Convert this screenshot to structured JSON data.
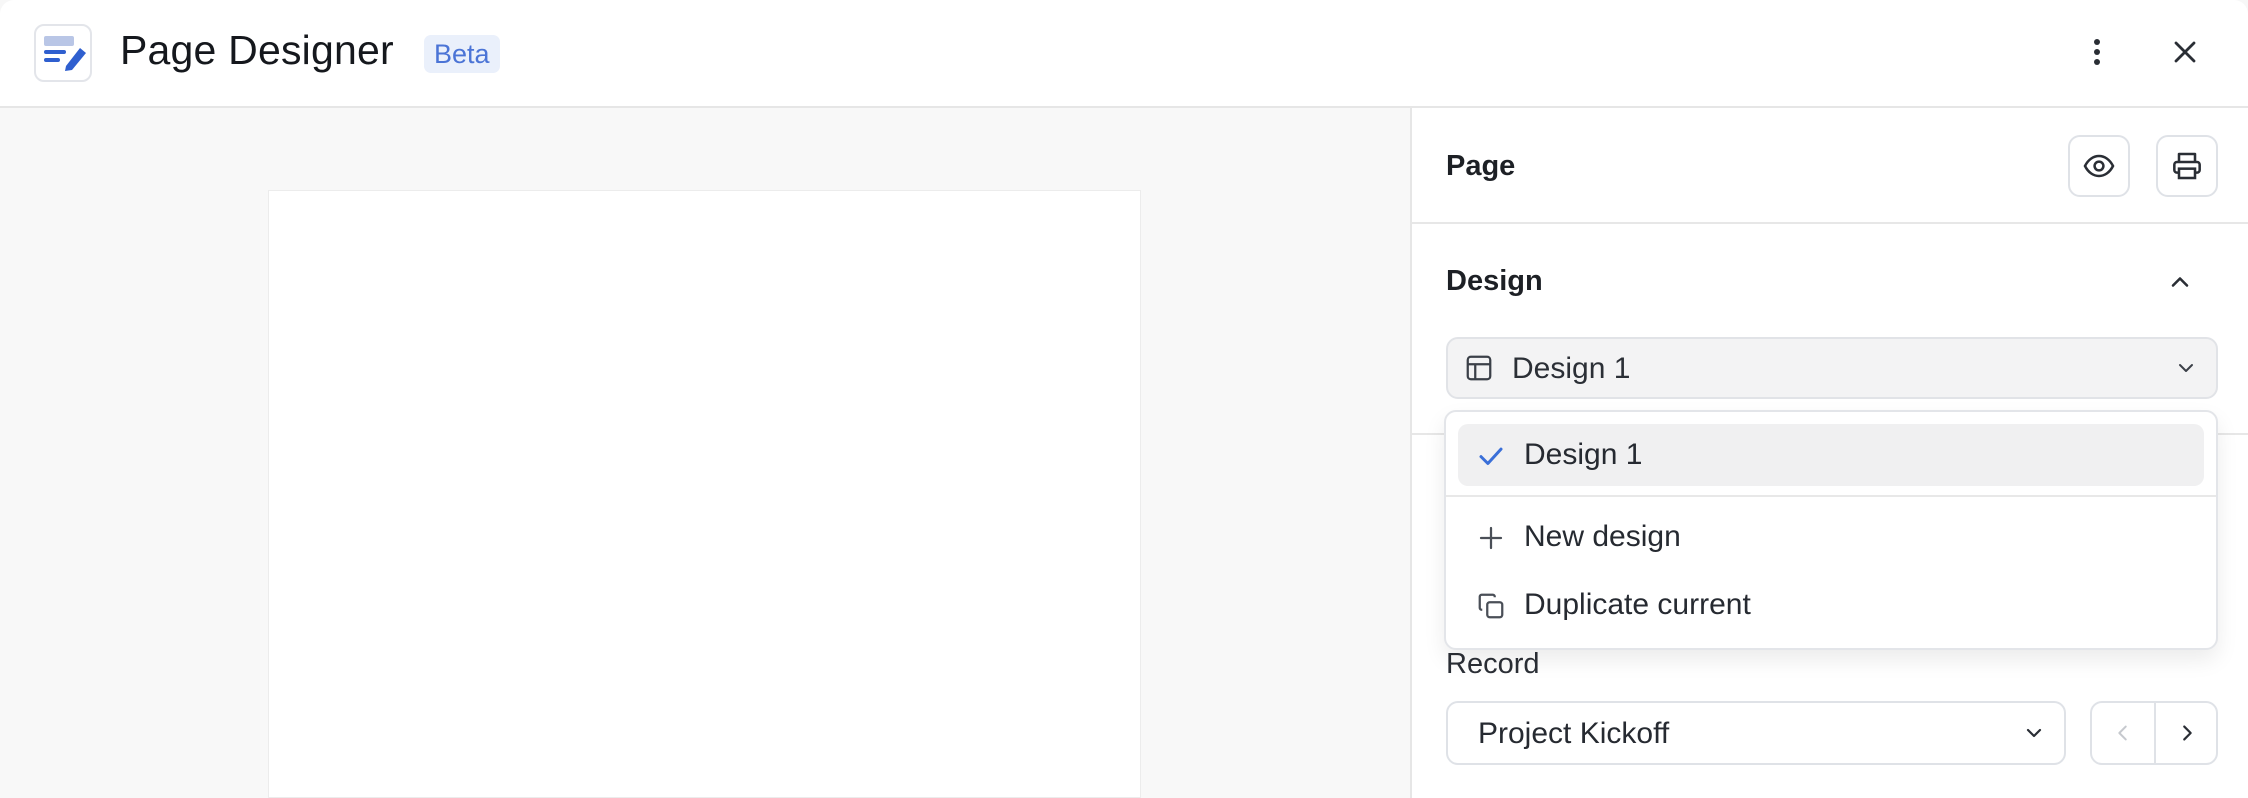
{
  "header": {
    "title": "Page Designer",
    "badge": "Beta",
    "icons": {
      "app": "page-designer-icon",
      "more": "more-vertical-icon",
      "close": "close-icon"
    }
  },
  "panel": {
    "page_title": "Page",
    "preview_icon": "eye-icon",
    "print_icon": "printer-icon",
    "design_section_title": "Design",
    "design_collapse_icon": "chevron-up-icon",
    "design_select": {
      "value": "Design 1",
      "icon": "layout-icon",
      "chevron": "chevron-down-icon"
    },
    "dropdown": {
      "items": [
        {
          "label": "Design 1",
          "icon": "check-icon",
          "selected": true
        },
        {
          "label": "New design",
          "icon": "plus-icon"
        },
        {
          "label": "Duplicate current",
          "icon": "copy-icon"
        }
      ]
    },
    "record_label": "Record",
    "record_select": {
      "value": "Project Kickoff",
      "chevron": "chevron-down-icon"
    },
    "record_nav": {
      "prev_icon": "chevron-left-icon",
      "next_icon": "chevron-right-icon"
    }
  },
  "colors": {
    "accent": "#4b74d6",
    "badge_bg": "#eaf0fb",
    "check": "#3a6fd8"
  }
}
